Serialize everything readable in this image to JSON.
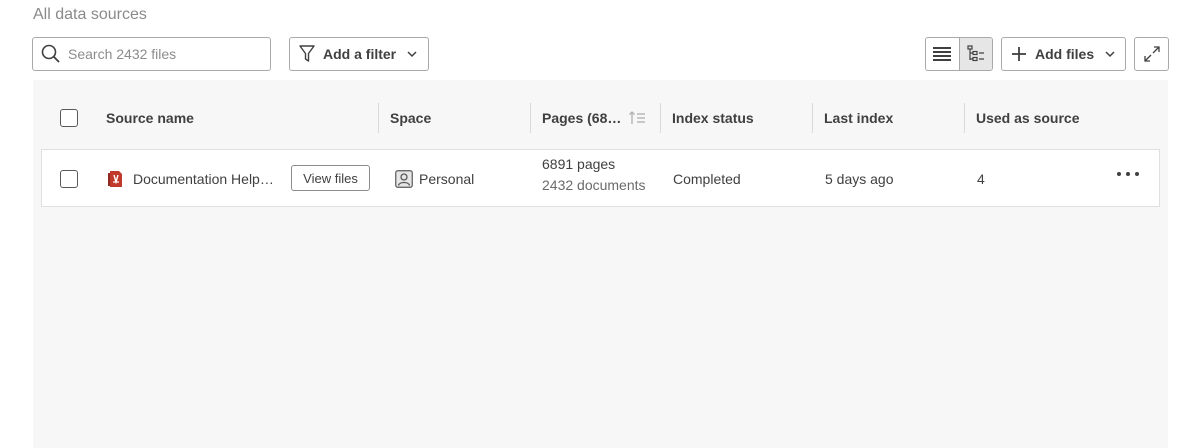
{
  "breadcrumb": "All data sources",
  "toolbar": {
    "search_placeholder": "Search 2432 files",
    "filter_label": "Add a filter",
    "add_files_label": "Add files",
    "view_modes": [
      "list-view-icon",
      "tree-view-icon"
    ],
    "active_view": "tree-view-icon"
  },
  "table": {
    "columns": [
      "Source name",
      "Space",
      "Pages (68…",
      "Index status",
      "Last index",
      "Used as source"
    ],
    "rows": [
      {
        "source_name": "Documentation Help…",
        "source_icon": "pdf-stack-icon",
        "view_files_label": "View files",
        "space": "Personal",
        "space_icon": "person-icon",
        "pages": "6891 pages",
        "documents": "2432 documents",
        "index_status": "Completed",
        "last_index": "5 days ago",
        "used_as_source": "4"
      }
    ]
  },
  "colors": {
    "panel_bg": "#f7f7f7",
    "border": "#a9a9a9",
    "source_icon_red": "#c0392b"
  }
}
